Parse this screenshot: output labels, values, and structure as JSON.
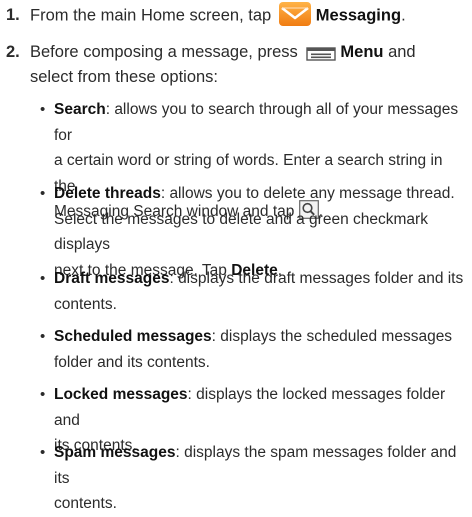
{
  "steps": [
    {
      "num": "1.",
      "prefix": "From the main Home screen, tap",
      "bold": "Messaging",
      "suffix": "."
    },
    {
      "num": "2.",
      "prefix": "Before composing a message, press",
      "bold": "Menu",
      "suffix": " and",
      "line2": "select from these options:"
    }
  ],
  "options": [
    {
      "term": "Search",
      "desc_a": ": allows you to search through all of your messages for",
      "desc_b": "a certain word or string of words. Enter a search string in the",
      "desc_c": "Messaging Search window and tap",
      "desc_end": "."
    },
    {
      "term": "Delete threads",
      "desc_a": ": allows you to delete any message thread.",
      "desc_b": "Select the messages to delete and a green checkmark displays",
      "desc_c": "next to the message. Tap ",
      "bold_end": "Delete",
      "desc_end": "."
    },
    {
      "term": "Draft messages",
      "desc_a": ": displays the draft messages folder and its",
      "desc_b": "contents."
    },
    {
      "term": "Scheduled messages",
      "desc_a": ": displays the scheduled messages",
      "desc_b": "folder and its contents."
    },
    {
      "term": "Locked messages",
      "desc_a": ": displays the locked messages folder and",
      "desc_b": "its contents."
    },
    {
      "term": "Spam messages",
      "desc_a": ": displays the spam messages folder and its",
      "desc_b": "contents."
    }
  ],
  "icons": {
    "messaging": "messaging-app-icon",
    "menu": "menu-key-icon",
    "search": "search-icon"
  },
  "colors": {
    "messaging_orange": "#f28a1a",
    "envelope": "#ffffff",
    "text": "#2b2b2b"
  }
}
